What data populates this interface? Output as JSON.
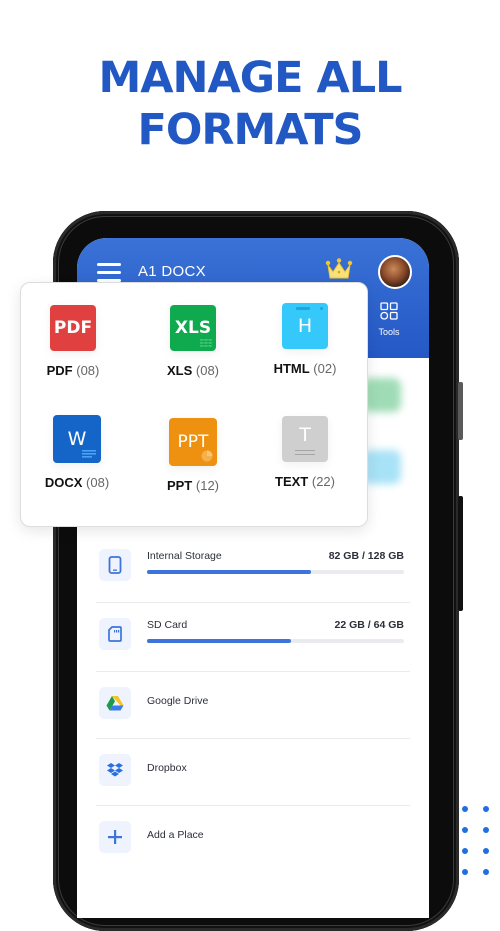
{
  "headline": {
    "line1": "MANAGE ALL",
    "line2": "FORMATS"
  },
  "app": {
    "title": "A1 DOCX",
    "menu_icon": "hamburger-menu-icon",
    "premium_icon": "crown-icon",
    "avatar_icon": "user-avatar",
    "tools_label": "Tools",
    "tools_icon": "grid-tools-icon"
  },
  "formats": [
    {
      "name": "PDF",
      "count": "(08)",
      "tile_text": "PDF",
      "color": "#e0403f",
      "icon": "pdf-file-icon"
    },
    {
      "name": "XLS",
      "count": "(08)",
      "tile_text": "XLS",
      "color": "#0fa94e",
      "icon": "xls-file-icon"
    },
    {
      "name": "HTML",
      "count": "(02)",
      "tile_text": "H",
      "color": "#35c8fb",
      "icon": "html-file-icon"
    },
    {
      "name": "DOCX",
      "count": "(08)",
      "tile_text": "W",
      "color": "#1565c8",
      "icon": "docx-file-icon"
    },
    {
      "name": "PPT",
      "count": "(12)",
      "tile_text": "PPT",
      "color": "#ee9010",
      "icon": "ppt-file-icon"
    },
    {
      "name": "TEXT",
      "count": "(22)",
      "tile_text": "T",
      "color": "#cfcfcf",
      "icon": "text-file-icon"
    }
  ],
  "storage": [
    {
      "name": "Internal Storage",
      "size": "82 GB / 128 GB",
      "used_fraction": 0.64,
      "icon": "phone-icon"
    },
    {
      "name": "SD Card",
      "size": "22 GB / 64 GB",
      "used_fraction": 0.56,
      "icon": "sd-card-icon"
    }
  ],
  "places": [
    {
      "name": "Google Drive",
      "icon": "google-drive-icon"
    },
    {
      "name": "Dropbox",
      "icon": "dropbox-icon"
    },
    {
      "name": "Add a Place",
      "icon": "plus-icon"
    }
  ],
  "colors": {
    "brand": "#2458c6",
    "headline": "#2258c4",
    "progress": "#3d74dc",
    "dots": "#1f6fe0"
  }
}
